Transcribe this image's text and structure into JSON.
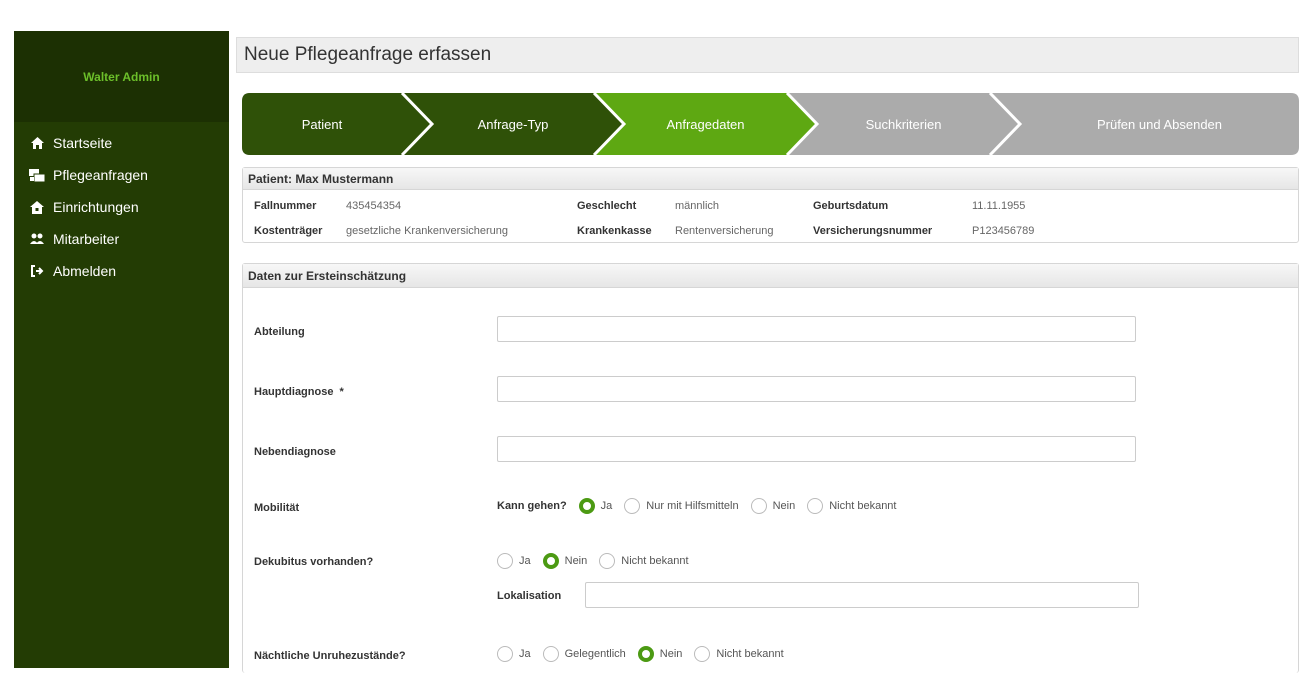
{
  "sidebar": {
    "user_name": "Walter Admin",
    "items": [
      {
        "label": "Startseite",
        "icon": "home-icon"
      },
      {
        "label": "Pflegeanfragen",
        "icon": "requests-icon"
      },
      {
        "label": "Einrichtungen",
        "icon": "facility-icon"
      },
      {
        "label": "Mitarbeiter",
        "icon": "users-icon"
      },
      {
        "label": "Abmelden",
        "icon": "logout-icon"
      }
    ]
  },
  "page": {
    "title": "Neue Pflegeanfrage erfassen"
  },
  "wizard": {
    "steps": [
      {
        "label": "Patient",
        "state": "done"
      },
      {
        "label": "Anfrage-Typ",
        "state": "done"
      },
      {
        "label": "Anfragedaten",
        "state": "active"
      },
      {
        "label": "Suchkriterien",
        "state": "todo"
      },
      {
        "label": "Prüfen und Absenden",
        "state": "todo"
      }
    ],
    "colors": {
      "done": "#2f5108",
      "active": "#5ea812",
      "todo": "#ababab"
    }
  },
  "patient": {
    "header": "Patient: Max Mustermann",
    "fields": {
      "fallnummer_label": "Fallnummer",
      "fallnummer_value": "435454354",
      "geschlecht_label": "Geschlecht",
      "geschlecht_value": "männlich",
      "geburtsdatum_label": "Geburtsdatum",
      "geburtsdatum_value": "11.11.1955",
      "kostentraeger_label": "Kostenträger",
      "kostentraeger_value": "gesetzliche Krankenversicherung",
      "krankenkasse_label": "Krankenkasse",
      "krankenkasse_value": "Rentenversicherung",
      "versicherungsnummer_label": "Versicherungsnummer",
      "versicherungsnummer_value": "P123456789"
    }
  },
  "assessment": {
    "header": "Daten zur Ersteinschätzung",
    "abteilung": {
      "label": "Abteilung",
      "value": ""
    },
    "hauptdiagnose": {
      "label": "Hauptdiagnose  *",
      "value": ""
    },
    "nebendiagnose": {
      "label": "Nebendiagnose",
      "value": ""
    },
    "mobilitaet": {
      "label": "Mobilität",
      "question": "Kann gehen?",
      "options": [
        "Ja",
        "Nur mit Hilfsmitteln",
        "Nein",
        "Nicht bekannt"
      ],
      "selected": "Ja"
    },
    "dekubitus": {
      "label": "Dekubitus vorhanden?",
      "options": [
        "Ja",
        "Nein",
        "Nicht bekannt"
      ],
      "selected": "Nein",
      "lokalisation_label": "Lokalisation",
      "lokalisation_value": ""
    },
    "unruhe": {
      "label": "Nächtliche Unruhezustände?",
      "options": [
        "Ja",
        "Gelegentlich",
        "Nein",
        "Nicht bekannt"
      ],
      "selected": "Nein"
    }
  }
}
